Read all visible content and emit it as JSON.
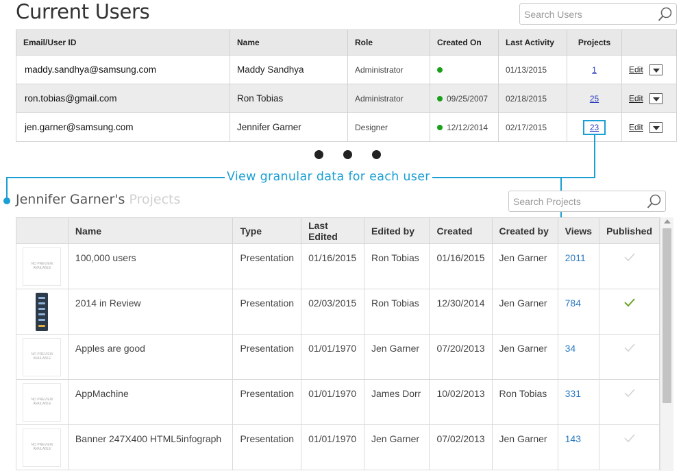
{
  "header": {
    "title": "Current Users",
    "search_placeholder": "Search Users"
  },
  "users_table": {
    "columns": [
      "Email/User ID",
      "Name",
      "Role",
      "Created On",
      "Last Activity",
      "Projects",
      ""
    ],
    "edit_label": "Edit",
    "rows": [
      {
        "email": "maddy.sandhya@samsung.com",
        "name": "Maddy Sandhya",
        "role": "Administrator",
        "created": "",
        "last_activity": "01/13/2015",
        "projects": "1"
      },
      {
        "email": "ron.tobias@gmail.com",
        "name": "Ron Tobias",
        "role": "Administrator",
        "created": "09/25/2007",
        "last_activity": "02/18/2015",
        "projects": "25"
      },
      {
        "email": "jen.garner@samsung.com",
        "name": "Jennifer Garner",
        "role": "Designer",
        "created": "12/12/2014",
        "last_activity": "02/17/2015",
        "projects": "23"
      }
    ]
  },
  "callout": {
    "text": "View granular data for each user"
  },
  "projects": {
    "title_owner": "Jennifer Garner's",
    "title_suffix": "Projects",
    "search_placeholder": "Search Projects",
    "no_preview_text": "NO PREVIEW AVAILABLE",
    "columns": [
      "",
      "Name",
      "Type",
      "Last Edited",
      "Edited by",
      "Created",
      "Created by",
      "Views",
      "Published"
    ],
    "rows": [
      {
        "name": "100,000 users",
        "type": "Presentation",
        "last_edited": "01/16/2015",
        "edited_by": "Ron Tobias",
        "created": "01/16/2015",
        "created_by": "Jen Garner",
        "views": "2011",
        "published": false,
        "preview": false
      },
      {
        "name": "2014 in Review",
        "type": "Presentation",
        "last_edited": "02/03/2015",
        "edited_by": "Ron Tobias",
        "created": "12/30/2014",
        "created_by": "Jen Garner",
        "views": "784",
        "published": true,
        "preview": true
      },
      {
        "name": "Apples are good",
        "type": "Presentation",
        "last_edited": "01/01/1970",
        "edited_by": "Jen Garner",
        "created": "07/20/2013",
        "created_by": "Jen Garner",
        "views": "34",
        "published": false,
        "preview": false
      },
      {
        "name": "AppMachine",
        "type": "Presentation",
        "last_edited": "01/01/1970",
        "edited_by": "James Dorr",
        "created": "10/02/2013",
        "created_by": "Ron Tobias",
        "views": "331",
        "published": false,
        "preview": false
      },
      {
        "name": "Banner 247X400 HTML5infograph",
        "type": "Presentation",
        "last_edited": "01/01/1970",
        "edited_by": "Jen Garner",
        "created": "07/02/2013",
        "created_by": "Jen Garner",
        "views": "143",
        "published": false,
        "preview": false
      }
    ]
  },
  "colors": {
    "accent": "#1a9fd4",
    "status_active": "#1aa01a",
    "published_check": "#6aa22a",
    "unpublished_check": "#d0d0d0",
    "link": "#2a3fbf"
  },
  "icons": {
    "search": "magnifier-icon",
    "dropdown": "caret-down-icon",
    "published": "checkmark-icon"
  }
}
